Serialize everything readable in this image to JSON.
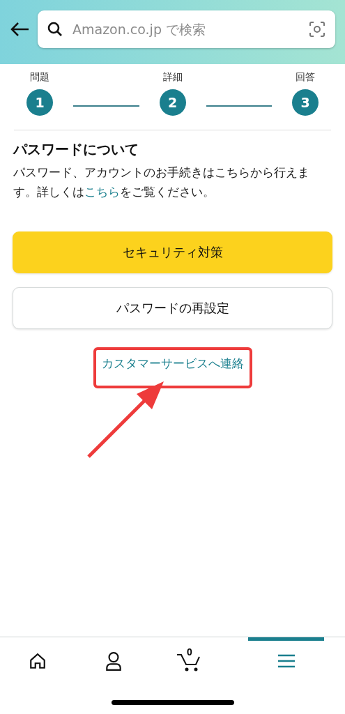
{
  "header": {
    "search": {
      "placeholder": "Amazon.co.jp で検索"
    }
  },
  "steps": [
    {
      "label": "問題",
      "number": "1"
    },
    {
      "label": "詳細",
      "number": "2"
    },
    {
      "label": "回答",
      "number": "3"
    }
  ],
  "section": {
    "title": "パスワードについて",
    "text_before": "パスワード、アカウントのお手続きはこちらから行えます。詳しくは",
    "link": "こちら",
    "text_after": "をご覧ください。"
  },
  "buttons": [
    {
      "label": "セキュリティ対策",
      "kind": "primary"
    },
    {
      "label": "パスワードの再設定",
      "kind": "secondary"
    }
  ],
  "contact_link": "カスタマーサービスへ連絡",
  "bottom_nav": [
    {
      "kind": "home",
      "selected": false
    },
    {
      "kind": "account",
      "selected": false
    },
    {
      "kind": "cart",
      "selected": false,
      "count": "0"
    },
    {
      "kind": "menu",
      "selected": true
    }
  ]
}
